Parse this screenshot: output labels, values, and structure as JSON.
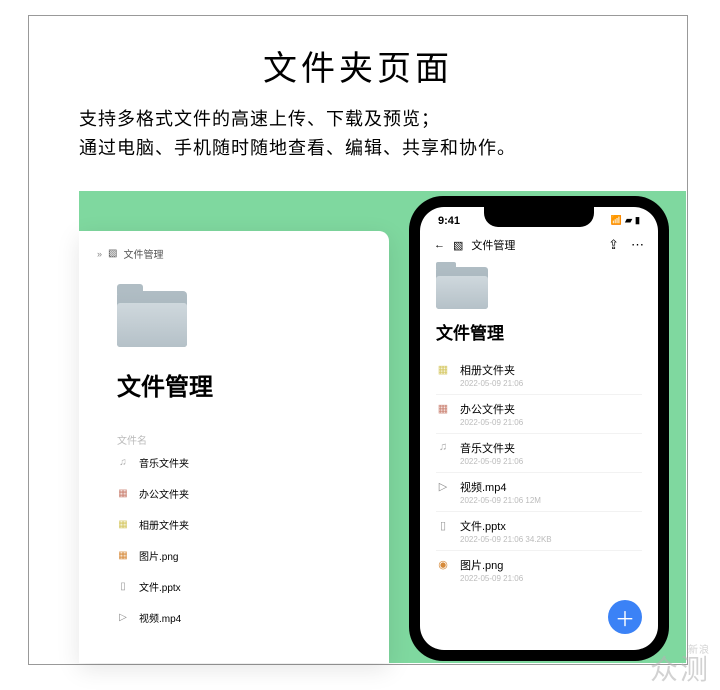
{
  "page": {
    "title": "文件夹页面",
    "desc_line1": "支持多格式文件的高速上传、下载及预览；",
    "desc_line2": "通过电脑、手机随时随地查看、编辑、共享和协作。"
  },
  "desktop": {
    "breadcrumb_label": "文件管理",
    "heading": "文件管理",
    "column_label": "文件名",
    "rows": [
      {
        "icon": "♫",
        "cls": "ic-music",
        "name": "音乐文件夹"
      },
      {
        "icon": "▦",
        "cls": "ic-office",
        "name": "办公文件夹"
      },
      {
        "icon": "▦",
        "cls": "ic-album",
        "name": "相册文件夹"
      },
      {
        "icon": "▦",
        "cls": "ic-img",
        "name": "图片.png"
      },
      {
        "icon": "▯",
        "cls": "ic-pptx",
        "name": "文件.pptx"
      },
      {
        "icon": "▷",
        "cls": "ic-video",
        "name": "视频.mp4"
      }
    ]
  },
  "phone": {
    "time": "9:41",
    "breadcrumb_label": "文件管理",
    "heading": "文件管理",
    "rows": [
      {
        "icon": "▦",
        "cls": "ic-album",
        "name": "相册文件夹",
        "meta": "2022-05-09 21:06"
      },
      {
        "icon": "▦",
        "cls": "ic-office",
        "name": "办公文件夹",
        "meta": "2022-05-09 21:06"
      },
      {
        "icon": "♫",
        "cls": "ic-music",
        "name": "音乐文件夹",
        "meta": "2022-05-09 21:06"
      },
      {
        "icon": "▷",
        "cls": "ic-video",
        "name": "视频.mp4",
        "meta": "2022-05-09 21:06   12M"
      },
      {
        "icon": "▯",
        "cls": "ic-pptx",
        "name": "文件.pptx",
        "meta": "2022-05-09 21:06   34.2KB"
      },
      {
        "icon": "◉",
        "cls": "ic-img",
        "name": "图片.png",
        "meta": "2022-05-09 21:06"
      }
    ],
    "fab_label": "＋"
  },
  "watermark": {
    "small": "新浪",
    "big": "众测"
  }
}
